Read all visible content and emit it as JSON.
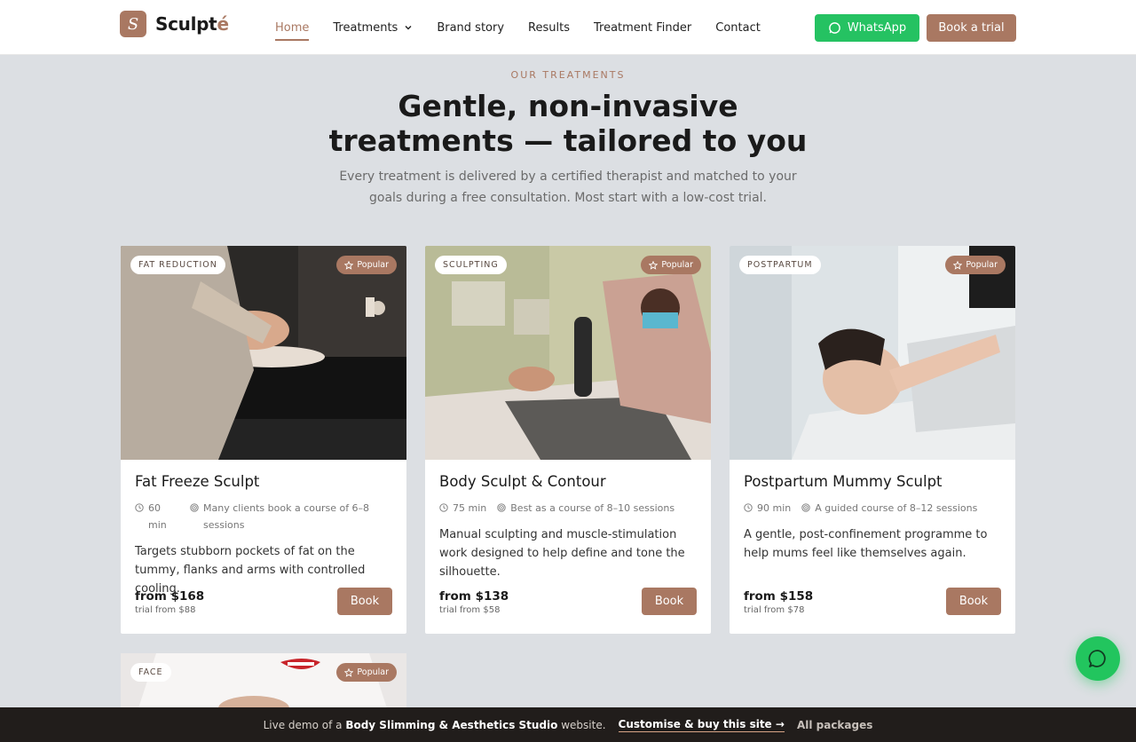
{
  "header": {
    "logo_letter": "S",
    "logo_text": "Sculpt",
    "logo_accent": "é",
    "nav": [
      {
        "label": "Home"
      },
      {
        "label": "Treatments"
      },
      {
        "label": "Brand story"
      },
      {
        "label": "Results"
      },
      {
        "label": "Treatment Finder"
      },
      {
        "label": "Contact"
      }
    ],
    "whatsapp_label": "WhatsApp",
    "book_trial_label": "Book a trial"
  },
  "section": {
    "eyebrow": "OUR TREATMENTS",
    "headline": "Gentle, non-invasive treatments — tailored to you",
    "subhead": "Every treatment is delivered by a certified therapist and matched to your goals during a free consultation. Most start with a low-cost trial."
  },
  "cards": [
    {
      "tag": "FAT REDUCTION",
      "badge": "Popular",
      "title": "Fat Freeze Sculpt",
      "duration": "60 min",
      "sessions": "Many clients book a course of 6–8 sessions",
      "description": "Targets stubborn pockets of fat on the tummy, flanks and arms with controlled cooling.",
      "price": "from $168",
      "trial": "trial from $88",
      "book_label": "Book"
    },
    {
      "tag": "SCULPTING",
      "badge": "Popular",
      "title": "Body Sculpt & Contour",
      "duration": "75 min",
      "sessions": "Best as a course of 8–10 sessions",
      "description": "Manual sculpting and muscle-stimulation work designed to help define and tone the silhouette.",
      "price": "from $138",
      "trial": "trial from $58",
      "book_label": "Book"
    },
    {
      "tag": "POSTPARTUM",
      "badge": "Popular",
      "title": "Postpartum Mummy Sculpt",
      "duration": "90 min",
      "sessions": "A guided course of 8–12 sessions",
      "description": "A gentle, post-confinement programme to help mums feel like themselves again.",
      "price": "from $158",
      "trial": "trial from $78",
      "book_label": "Book"
    },
    {
      "tag": "FACE",
      "badge": "Popular"
    }
  ],
  "banner": {
    "prefix": "Live demo of a",
    "site_type": "Body Slimming & Aesthetics Studio",
    "suffix": "website.",
    "cta": "Customise & buy this site →",
    "packages": "All packages"
  },
  "icons": {
    "whatsapp": "whatsapp-icon",
    "chat": "chat-bubble-icon",
    "star": "star-icon",
    "clock": "clock-icon",
    "target": "target-icon"
  },
  "colors": {
    "brand": "#a97862",
    "whatsapp": "#25c262",
    "page_bg": "#dcdfe3",
    "banner_bg": "#211d1b"
  }
}
